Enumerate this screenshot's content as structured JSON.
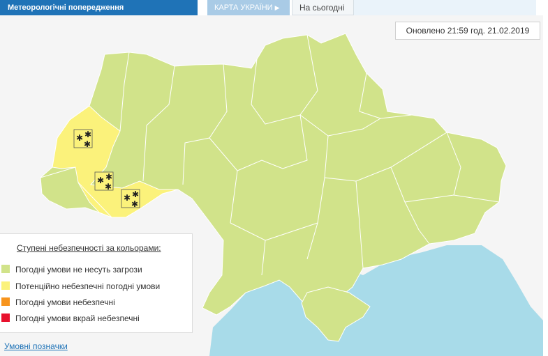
{
  "header": {
    "title": "Метеорологічні попередження",
    "map_tab": "КАРТА УКРАЇНИ",
    "today_tab": "На сьогодні"
  },
  "updated": "Оновлено 21:59 год. 21.02.2019",
  "legend": {
    "title": "Ступені небезпечності за кольорами:",
    "items": [
      {
        "label": "Погодні умови не несуть загрози",
        "color": "#d1e38a"
      },
      {
        "label": "Потенційно небезпечні погодні умови",
        "color": "#fbf27b"
      },
      {
        "label": "Погодні умови небезпечні",
        "color": "#f7941d"
      },
      {
        "label": "Погодні умови вкрай небезпечні",
        "color": "#e8112d"
      }
    ]
  },
  "footer": {
    "conventions_link": "Умовні позначки"
  },
  "map": {
    "sea_color": "#a8dbe9",
    "land_color": "#d1e38a",
    "warning_color": "#fbf27b",
    "warning_icon": "snow-icon",
    "warned_regions": [
      "lviv-region",
      "ivano-frankivsk-region",
      "chernivtsi-region"
    ]
  }
}
